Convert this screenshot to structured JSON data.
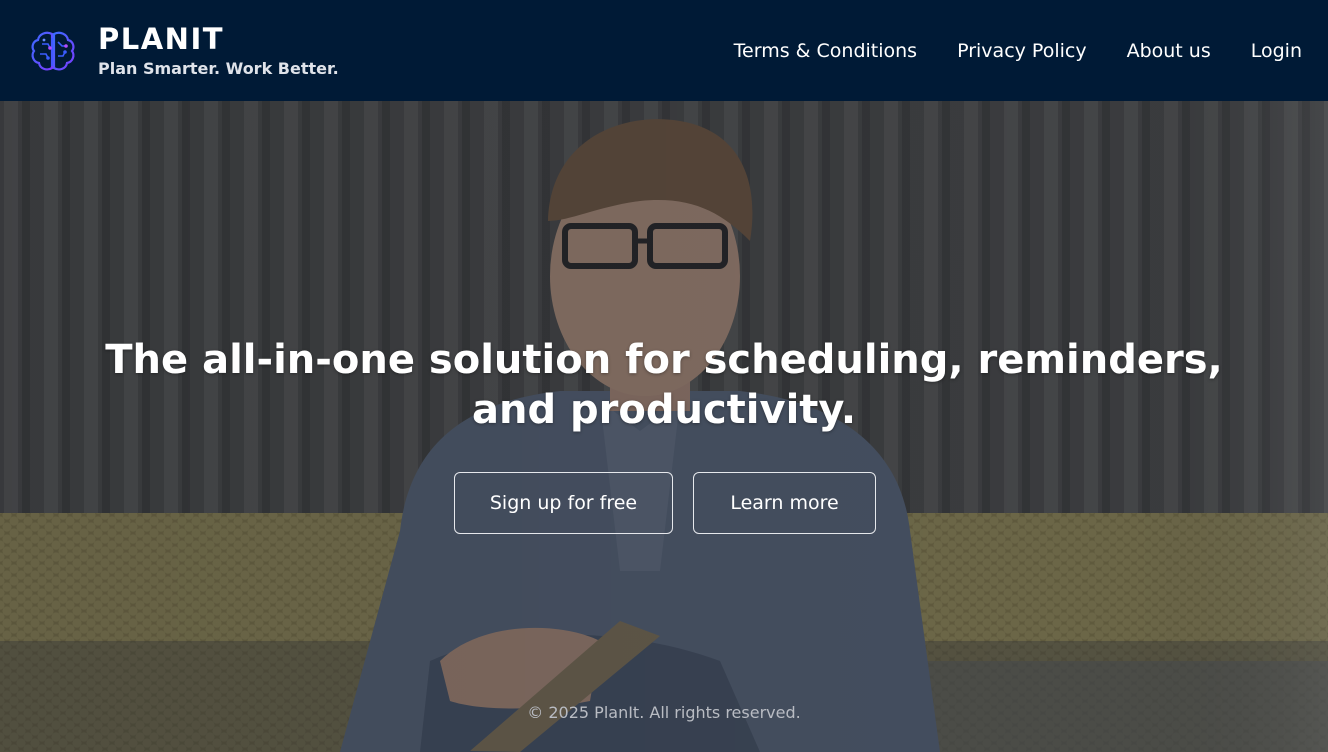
{
  "header": {
    "brand_name": "PLANIT",
    "tagline": "Plan Smarter. Work Better.",
    "logo_icon": "brain-circuit-icon",
    "nav": [
      {
        "label": "Terms & Conditions"
      },
      {
        "label": "Privacy Policy"
      },
      {
        "label": "About us"
      },
      {
        "label": "Login"
      }
    ]
  },
  "hero": {
    "headline": "The all-in-one solution for scheduling, reminders, and productivity.",
    "primary_cta": "Sign up for free",
    "secondary_cta": "Learn more",
    "background_image": "man-writing-in-notebook-on-sofa-photo"
  },
  "footer": {
    "copyright": "© 2025 PlanIt. All rights reserved."
  },
  "colors": {
    "header_bg": "#001a36",
    "text_primary": "#ffffff",
    "logo_accent": "#3a5cff",
    "logo_highlight": "#b14cff"
  }
}
